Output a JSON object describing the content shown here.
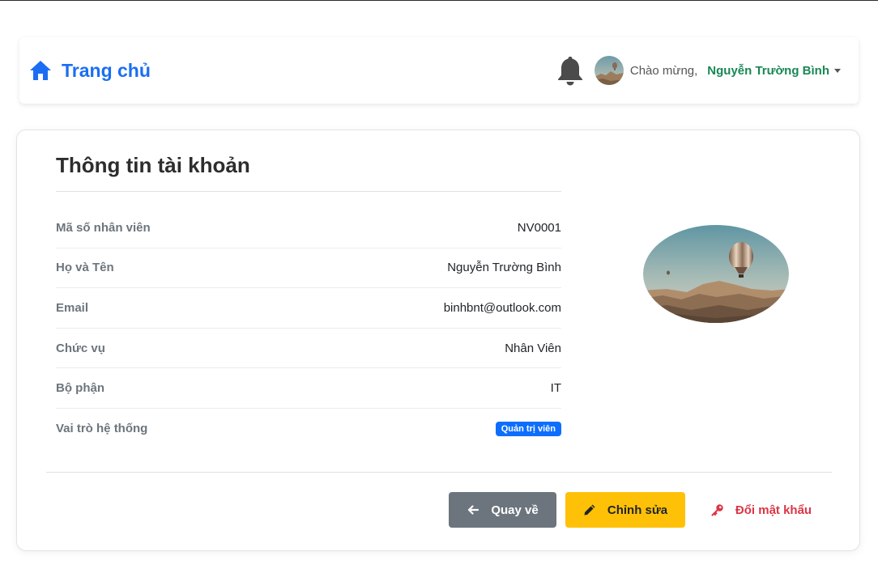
{
  "navbar": {
    "brand_label": "Trang chủ",
    "greeting": "Chào mừng,",
    "user_name": "Nguyễn Trường Bình"
  },
  "card": {
    "title": "Thông tin tài khoản",
    "fields": [
      {
        "label": "Mã số nhân viên",
        "value": "NV0001"
      },
      {
        "label": "Họ và Tên",
        "value": "Nguyễn Trường Bình"
      },
      {
        "label": "Email",
        "value": "binhbnt@outlook.com"
      },
      {
        "label": "Chức vụ",
        "value": "Nhân Viên"
      },
      {
        "label": "Bộ phận",
        "value": "IT"
      },
      {
        "label": "Vai trò hệ thống",
        "value": "Quản trị viên"
      }
    ]
  },
  "actions": {
    "back_label": "Quay về",
    "edit_label": "Chỉnh sửa",
    "change_password_label": "Đổi mật khẩu"
  },
  "icons": {
    "brand": "home-icon",
    "notifications": "bell-icon",
    "back": "arrow-left-icon",
    "edit": "pencil-icon",
    "password": "key-icon"
  },
  "colors": {
    "brand": "#1b6ef3",
    "user": "#198754",
    "back_button": "#6c757d",
    "edit_button": "#ffc107",
    "danger": "#dc3545",
    "badge": "#0d6efd"
  }
}
